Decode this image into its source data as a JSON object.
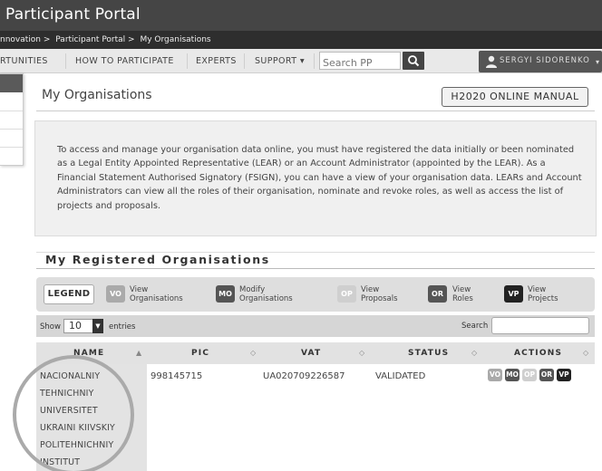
{
  "header": {
    "title": "Participant Portal",
    "breadcrumbs": [
      "nnovation >",
      "Participant Portal >",
      "My Organisations"
    ]
  },
  "nav": {
    "items": [
      "RTUNITIES",
      "HOW TO PARTICIPATE",
      "EXPERTS",
      "SUPPORT ▾"
    ],
    "search_placeholder": "Search PP",
    "user_name": "SERGYI SIDORENKO",
    "user_caret": "▾"
  },
  "page": {
    "title": "My Organisations",
    "manual_button": "H2020 ONLINE MANUAL",
    "info_text": "To access and manage your organisation data online, you must have registered the data initially or been nominated as a Legal Entity Appointed Representative (LEAR) or an Account Administrator (appointed by the LEAR). As a Financial Statement Authorised Signatory (FSIGN), you can have a view of your organisation data. LEARs and Account Administrators can view all the roles of their organisation, nominate and revoke roles, as well as access the list of projects and proposals."
  },
  "section": {
    "title": "My Registered Organisations"
  },
  "legend": {
    "title": "LEGEND",
    "items": [
      {
        "code": "VO",
        "line1": "View",
        "line2": "Organisations",
        "color": "#aaaaaa"
      },
      {
        "code": "MO",
        "line1": "Modify",
        "line2": "Organisations",
        "color": "#555555"
      },
      {
        "code": "OP",
        "line1": "View",
        "line2": "Proposals",
        "color": "#cfcfcf"
      },
      {
        "code": "OR",
        "line1": "View",
        "line2": "Roles",
        "color": "#555555"
      },
      {
        "code": "VP",
        "line1": "View",
        "line2": "Projects",
        "color": "#222222"
      }
    ]
  },
  "table": {
    "show_label": "Show",
    "page_size": "10",
    "entries_label": "entries",
    "search_label": "Search",
    "columns": [
      "NAME",
      "PIC",
      "VAT",
      "STATUS",
      "ACTIONS"
    ],
    "rows": [
      {
        "name_lines": [
          "NACIONALNIY",
          "TEHNICHNIY",
          "UNIVERSITET",
          "UKRAINI KIIVSKIY",
          "POLITEHNICHNIY",
          "INSTITUT"
        ],
        "pic": "998145715",
        "vat": "UA020709226587",
        "status": "VALIDATED",
        "actions": [
          "VO",
          "MO",
          "OP",
          "OR",
          "VP"
        ]
      }
    ]
  },
  "colors": {
    "topbar": "#454545",
    "breadcrumb_bar": "#2e2e2e",
    "badge_vo": "#aaaaaa",
    "badge_mo": "#555555",
    "badge_op": "#cfcfcf",
    "badge_or": "#555555",
    "badge_vp": "#222222"
  }
}
